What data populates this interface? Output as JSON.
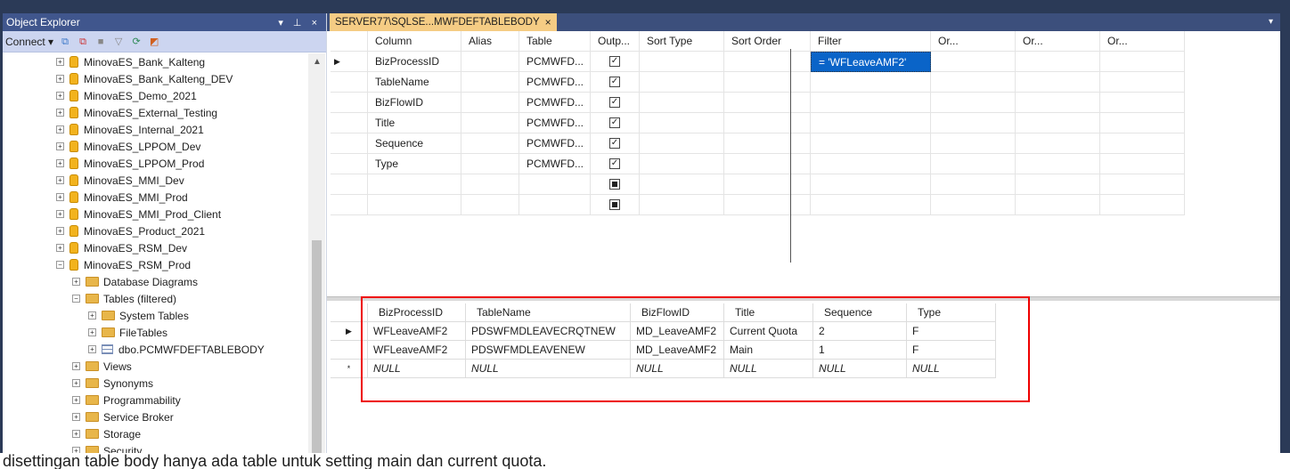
{
  "object_explorer": {
    "title": "Object Explorer",
    "title_controls": "▾ ⊥ ×",
    "toolbar": {
      "connect_label": "Connect ▾",
      "icons": [
        "connect-icon",
        "disconnect-icon",
        "stop-icon",
        "filter-icon",
        "refresh-icon",
        "activity-monitor-icon"
      ]
    },
    "tree": [
      {
        "label": "MinovaES_Bank_Kalteng",
        "type": "db",
        "indent": 0,
        "expand": "+"
      },
      {
        "label": "MinovaES_Bank_Kalteng_DEV",
        "type": "db",
        "indent": 0,
        "expand": "+"
      },
      {
        "label": "MinovaES_Demo_2021",
        "type": "db",
        "indent": 0,
        "expand": "+"
      },
      {
        "label": "MinovaES_External_Testing",
        "type": "db",
        "indent": 0,
        "expand": "+"
      },
      {
        "label": "MinovaES_Internal_2021",
        "type": "db",
        "indent": 0,
        "expand": "+"
      },
      {
        "label": "MinovaES_LPPOM_Dev",
        "type": "db",
        "indent": 0,
        "expand": "+"
      },
      {
        "label": "MinovaES_LPPOM_Prod",
        "type": "db",
        "indent": 0,
        "expand": "+"
      },
      {
        "label": "MinovaES_MMI_Dev",
        "type": "db",
        "indent": 0,
        "expand": "+"
      },
      {
        "label": "MinovaES_MMI_Prod",
        "type": "db",
        "indent": 0,
        "expand": "+"
      },
      {
        "label": "MinovaES_MMI_Prod_Client",
        "type": "db",
        "indent": 0,
        "expand": "+"
      },
      {
        "label": "MinovaES_Product_2021",
        "type": "db",
        "indent": 0,
        "expand": "+"
      },
      {
        "label": "MinovaES_RSM_Dev",
        "type": "db",
        "indent": 0,
        "expand": "+"
      },
      {
        "label": "MinovaES_RSM_Prod",
        "type": "db",
        "indent": 0,
        "expand": "−"
      },
      {
        "label": "Database Diagrams",
        "type": "folder",
        "indent": 1,
        "expand": "+"
      },
      {
        "label": "Tables (filtered)",
        "type": "folder",
        "indent": 1,
        "expand": "−"
      },
      {
        "label": "System Tables",
        "type": "folder",
        "indent": 2,
        "expand": "+"
      },
      {
        "label": "FileTables",
        "type": "folder",
        "indent": 2,
        "expand": "+"
      },
      {
        "label": "dbo.PCMWFDEFTABLEBODY",
        "type": "table",
        "indent": 2,
        "expand": "+"
      },
      {
        "label": "Views",
        "type": "folder",
        "indent": 1,
        "expand": "+"
      },
      {
        "label": "Synonyms",
        "type": "folder",
        "indent": 1,
        "expand": "+"
      },
      {
        "label": "Programmability",
        "type": "folder",
        "indent": 1,
        "expand": "+"
      },
      {
        "label": "Service Broker",
        "type": "folder",
        "indent": 1,
        "expand": "+"
      },
      {
        "label": "Storage",
        "type": "folder",
        "indent": 1,
        "expand": "+"
      },
      {
        "label": "Security",
        "type": "folder",
        "indent": 1,
        "expand": "+"
      }
    ]
  },
  "document": {
    "tab_label": "SERVER77\\SQLSE...MWFDEFTABLEBODY",
    "tab_close": "×",
    "tab_menu": "▾",
    "criteria_grid": {
      "headers": [
        "",
        "Column",
        "Alias",
        "Table",
        "Outp...",
        "Sort Type",
        "Sort Order",
        "Filter",
        "Or...",
        "Or...",
        "Or..."
      ],
      "rows": [
        {
          "selector": "▶",
          "column": "BizProcessID",
          "alias": "",
          "table": "PCMWFD...",
          "output": "checked",
          "sort_type": "",
          "sort_order": "",
          "filter": "= 'WFLeaveAMF2'"
        },
        {
          "selector": "",
          "column": "TableName",
          "alias": "",
          "table": "PCMWFD...",
          "output": "checked",
          "sort_type": "",
          "sort_order": "",
          "filter": ""
        },
        {
          "selector": "",
          "column": "BizFlowID",
          "alias": "",
          "table": "PCMWFD...",
          "output": "checked",
          "sort_type": "",
          "sort_order": "",
          "filter": ""
        },
        {
          "selector": "",
          "column": "Title",
          "alias": "",
          "table": "PCMWFD...",
          "output": "checked",
          "sort_type": "",
          "sort_order": "",
          "filter": ""
        },
        {
          "selector": "",
          "column": "Sequence",
          "alias": "",
          "table": "PCMWFD...",
          "output": "checked",
          "sort_type": "",
          "sort_order": "",
          "filter": ""
        },
        {
          "selector": "",
          "column": "Type",
          "alias": "",
          "table": "PCMWFD...",
          "output": "checked",
          "sort_type": "",
          "sort_order": "",
          "filter": ""
        },
        {
          "selector": "",
          "column": "",
          "alias": "",
          "table": "",
          "output": "indeterminate",
          "sort_type": "",
          "sort_order": "",
          "filter": ""
        },
        {
          "selector": "",
          "column": "",
          "alias": "",
          "table": "",
          "output": "indeterminate",
          "sort_type": "",
          "sort_order": "",
          "filter": ""
        }
      ]
    },
    "results_grid": {
      "headers": [
        "",
        "BizProcessID",
        "TableName",
        "BizFlowID",
        "Title",
        "Sequence",
        "Type"
      ],
      "rows": [
        {
          "selector": "▶",
          "cells": [
            "WFLeaveAMF2",
            "PDSWFMDLEAVECRQTNEW",
            "MD_LeaveAMF2",
            "Current Quota",
            "2",
            "F"
          ],
          "null": false
        },
        {
          "selector": "",
          "cells": [
            "WFLeaveAMF2",
            "PDSWFMDLEAVENEW",
            "MD_LeaveAMF2",
            "Main",
            "1",
            "F"
          ],
          "null": false
        },
        {
          "selector": "*",
          "cells": [
            "NULL",
            "NULL",
            "NULL",
            "NULL",
            "NULL",
            "NULL"
          ],
          "null": true
        }
      ]
    }
  },
  "caption": "disettingan table body hanya ada table untuk setting main dan current quota.",
  "colors": {
    "frame": "#2b3a57",
    "oe_title": "#40568d",
    "active_tab": "#f5cc84",
    "highlight_box": "#ee0000",
    "selected_filter": "#0a64c8"
  }
}
